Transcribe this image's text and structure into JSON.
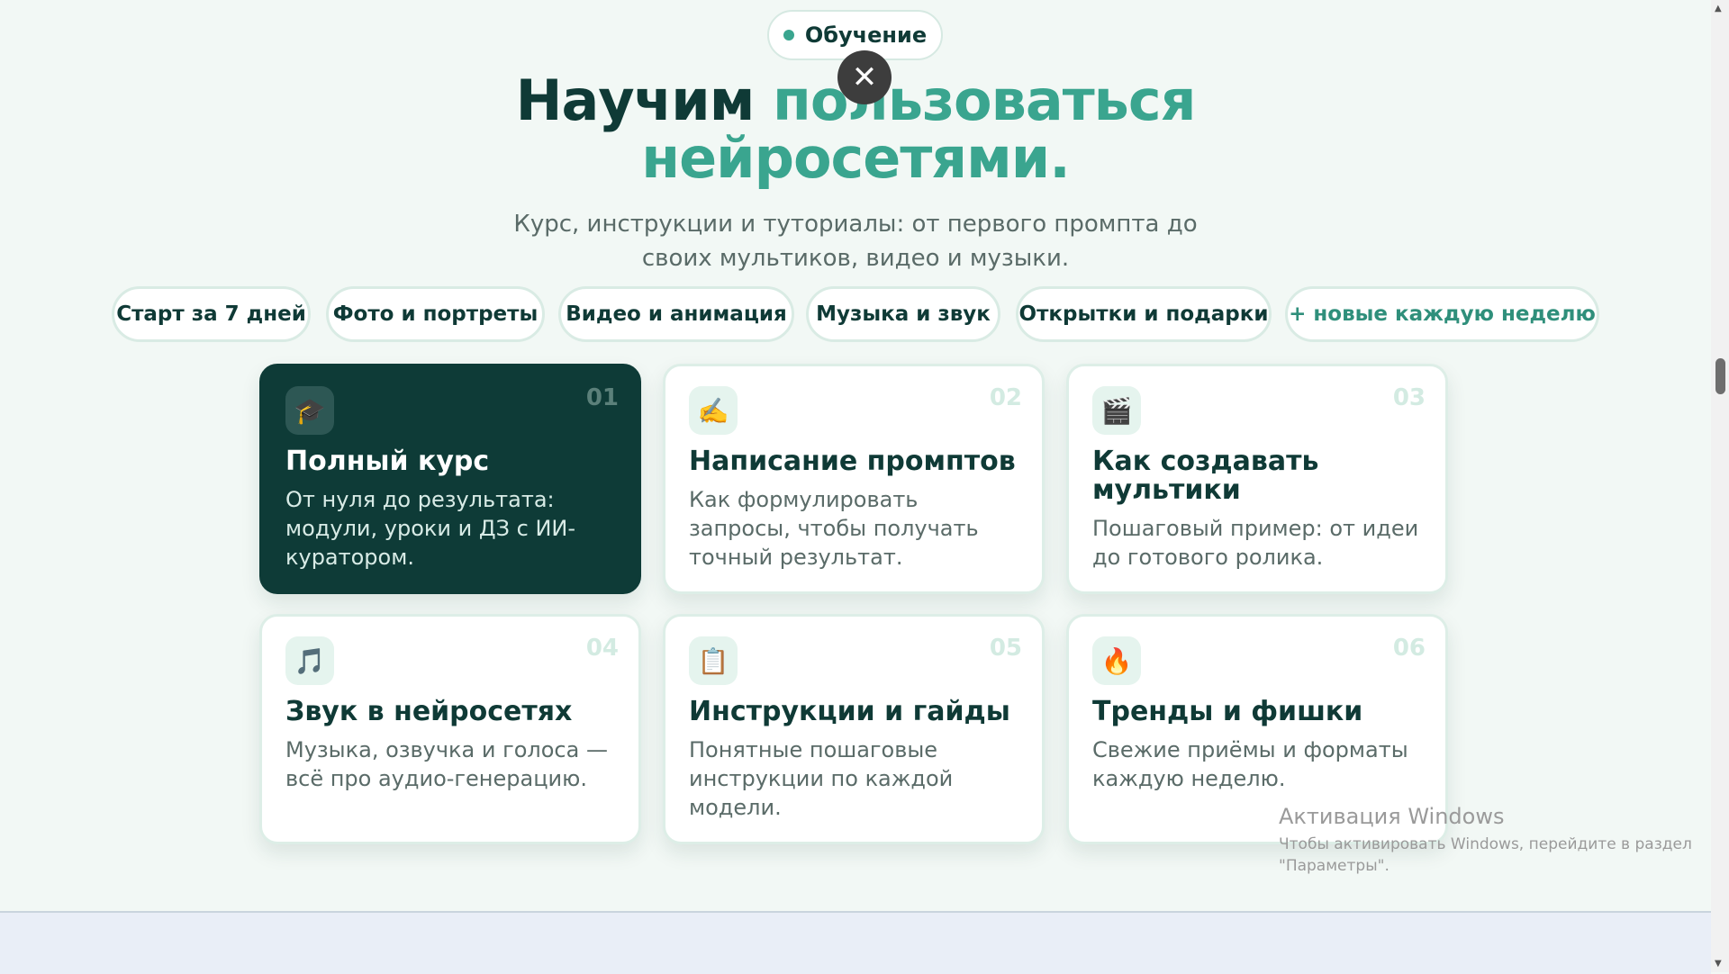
{
  "badge": {
    "label": "Обучение"
  },
  "close": {
    "symbol": "✕"
  },
  "hero": {
    "title_dark": "Научим",
    "title_accent_1": "пользоваться",
    "title_accent_2": "нейросетями."
  },
  "subtitle": "Курс, инструкции и туториалы: от первого промпта до своих мультиков, видео и музыки.",
  "pills": [
    "Старт за 7 дней",
    "Фото и портреты",
    "Видео и анимация",
    "Музыка и звук",
    "Открытки и подарки",
    "+ новые каждую неделю"
  ],
  "cards": [
    {
      "num": "01",
      "icon": "graduation-cap-icon",
      "glyph": "🎓",
      "title": "Полный курс",
      "desc": "От нуля до результата: модули, уроки и ДЗ с ИИ-куратором."
    },
    {
      "num": "02",
      "icon": "writing-hand-icon",
      "glyph": "✍️",
      "title": "Написание промптов",
      "desc": "Как формулировать запросы, чтобы получать точный результат."
    },
    {
      "num": "03",
      "icon": "clapper-board-icon",
      "glyph": "🎬",
      "title": "Как создавать мультики",
      "desc": "Пошаговый пример: от идеи до готового ролика."
    },
    {
      "num": "04",
      "icon": "music-note-icon",
      "glyph": "🎵",
      "title": "Звук в нейросетях",
      "desc": "Музыка, озвучка и голоса — всё про аудио-генерацию."
    },
    {
      "num": "05",
      "icon": "clipboard-icon",
      "glyph": "📋",
      "title": "Инструкции и гайды",
      "desc": "Понятные пошаговые инструкции по каждой модели."
    },
    {
      "num": "06",
      "icon": "fire-icon",
      "glyph": "🔥",
      "title": "Тренды и фишки",
      "desc": "Свежие приёмы и форматы каждую неделю."
    }
  ],
  "watermark": {
    "title": "Активация Windows",
    "text": "Чтобы активировать Windows, перейдите в раздел \"Параметры\"."
  },
  "colors": {
    "accent": "#3aa58f",
    "dark": "#0f3a36",
    "featured_card": "#0e3b37"
  }
}
